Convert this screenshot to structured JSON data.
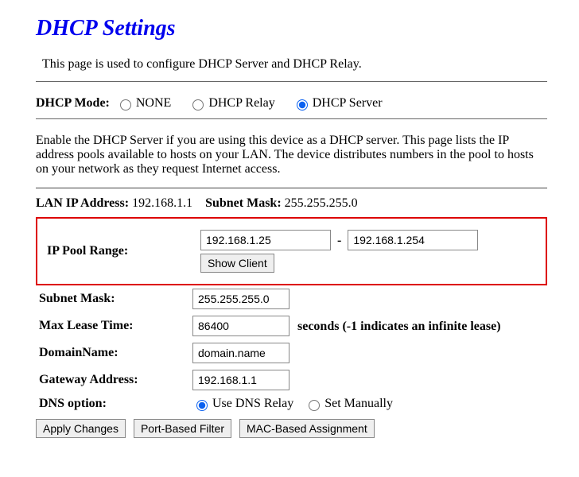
{
  "title": "DHCP Settings",
  "intro": "This page is used to configure DHCP Server and DHCP Relay.",
  "mode": {
    "label": "DHCP Mode:",
    "options": {
      "none": "NONE",
      "relay": "DHCP Relay",
      "server": "DHCP Server"
    },
    "selected": "server"
  },
  "description": "Enable the DHCP Server if you are using this device as a DHCP server. This page lists the IP address pools available to hosts on your LAN. The device distributes numbers in the pool to hosts on your network as they request Internet access.",
  "lan": {
    "ip_label": "LAN IP Address:",
    "ip_value": "192.168.1.1",
    "mask_label": "Subnet Mask:",
    "mask_value": "255.255.255.0"
  },
  "pool": {
    "label": "IP Pool Range:",
    "start": "192.168.1.25",
    "end": "192.168.1.254",
    "show_client": "Show Client"
  },
  "fields": {
    "subnet_mask": {
      "label": "Subnet Mask:",
      "value": "255.255.255.0"
    },
    "max_lease": {
      "label": "Max Lease Time:",
      "value": "86400",
      "note": "seconds (-1 indicates an infinite lease)"
    },
    "domain_name": {
      "label": "DomainName:",
      "value": "domain.name"
    },
    "gateway": {
      "label": "Gateway Address:",
      "value": "192.168.1.1"
    }
  },
  "dns": {
    "label": "DNS option:",
    "relay": "Use DNS Relay",
    "manual": "Set Manually",
    "selected": "relay"
  },
  "buttons": {
    "apply": "Apply Changes",
    "port_filter": "Port-Based Filter",
    "mac_assign": "MAC-Based Assignment"
  }
}
